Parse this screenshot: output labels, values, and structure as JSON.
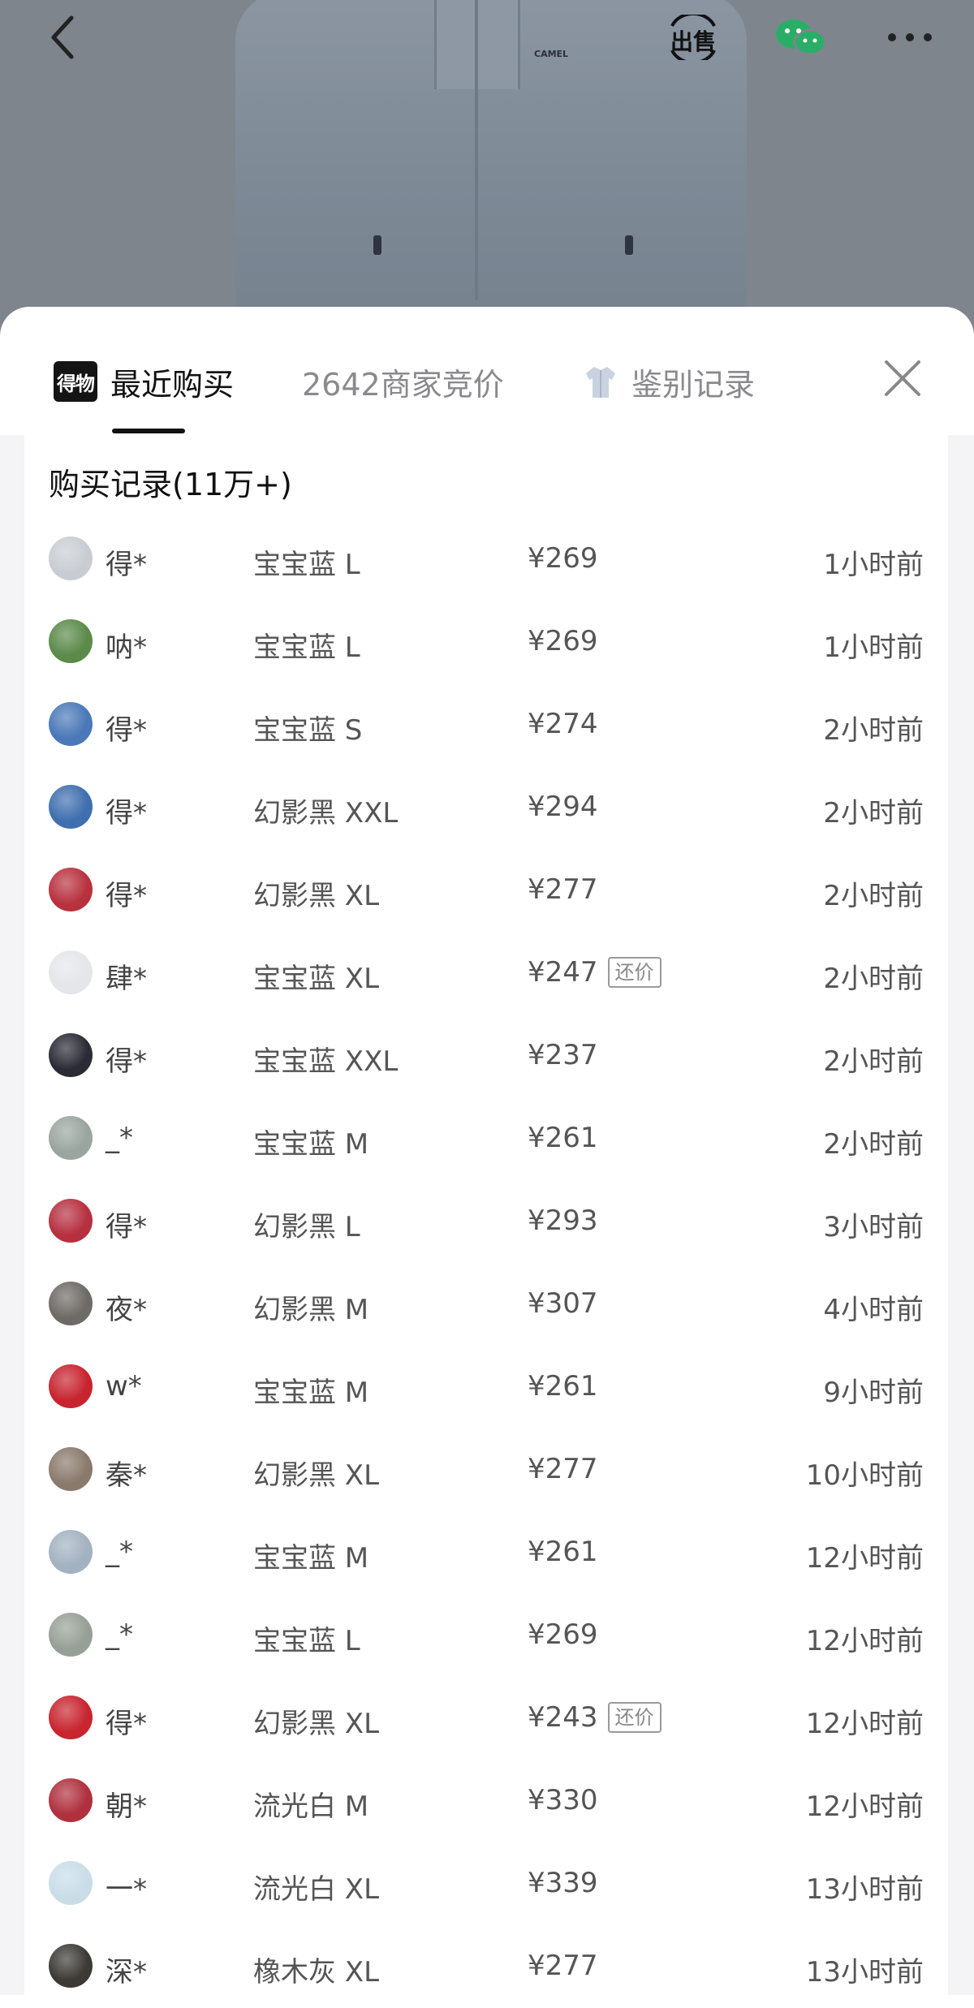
{
  "topbar": {
    "back_icon": "chevron-left-icon",
    "sell_label": "出售",
    "wechat_icon": "wechat-icon",
    "more_icon": "more-dots-icon"
  },
  "product": {
    "logo_text": "CAMEL"
  },
  "tabs": [
    {
      "label": "最近购买",
      "icon": "dewu-logo-icon",
      "icon_text": "得物",
      "active": true
    },
    {
      "label": "2642商家竞价",
      "active": false
    },
    {
      "label": "鉴别记录",
      "icon": "jacket-icon",
      "active": false
    }
  ],
  "section_title": "购买记录(11万+)",
  "colors": {
    "active": "#111111",
    "inactive": "#8a8a8e",
    "tag_border": "#9a9a9a"
  },
  "records": [
    {
      "user": "得*",
      "sku": "宝宝蓝 L",
      "price": "¥269",
      "tag": "",
      "time": "1小时前",
      "avatar_color": "#c9cdd3"
    },
    {
      "user": "呐*",
      "sku": "宝宝蓝 L",
      "price": "¥269",
      "tag": "",
      "time": "1小时前",
      "avatar_color": "#5b8a4a"
    },
    {
      "user": "得*",
      "sku": "宝宝蓝 S",
      "price": "¥274",
      "tag": "",
      "time": "2小时前",
      "avatar_color": "#4a78b8"
    },
    {
      "user": "得*",
      "sku": "幻影黑 XXL",
      "price": "¥294",
      "tag": "",
      "time": "2小时前",
      "avatar_color": "#3f6fae"
    },
    {
      "user": "得*",
      "sku": "幻影黑 XL",
      "price": "¥277",
      "tag": "",
      "time": "2小时前",
      "avatar_color": "#b8323e"
    },
    {
      "user": "肆*",
      "sku": "宝宝蓝 XL",
      "price": "¥247",
      "tag": "还价",
      "time": "2小时前",
      "avatar_color": "#e4e6ea"
    },
    {
      "user": "得*",
      "sku": "宝宝蓝 XXL",
      "price": "¥237",
      "tag": "",
      "time": "2小时前",
      "avatar_color": "#2a2b35"
    },
    {
      "user": "_*",
      "sku": "宝宝蓝 M",
      "price": "¥261",
      "tag": "",
      "time": "2小时前",
      "avatar_color": "#9aa5a0"
    },
    {
      "user": "得*",
      "sku": "幻影黑 L",
      "price": "¥293",
      "tag": "",
      "time": "3小时前",
      "avatar_color": "#b73040"
    },
    {
      "user": "夜*",
      "sku": "幻影黑 M",
      "price": "¥307",
      "tag": "",
      "time": "4小时前",
      "avatar_color": "#6e6a66"
    },
    {
      "user": "w*",
      "sku": "宝宝蓝 M",
      "price": "¥261",
      "tag": "",
      "time": "9小时前",
      "avatar_color": "#c8242f"
    },
    {
      "user": "秦*",
      "sku": "幻影黑 XL",
      "price": "¥277",
      "tag": "",
      "time": "10小时前",
      "avatar_color": "#8a7a6c"
    },
    {
      "user": "_*",
      "sku": "宝宝蓝 M",
      "price": "¥261",
      "tag": "",
      "time": "12小时前",
      "avatar_color": "#a3b2c0"
    },
    {
      "user": "_*",
      "sku": "宝宝蓝 L",
      "price": "¥269",
      "tag": "",
      "time": "12小时前",
      "avatar_color": "#97a097"
    },
    {
      "user": "得*",
      "sku": "幻影黑 XL",
      "price": "¥243",
      "tag": "还价",
      "time": "12小时前",
      "avatar_color": "#c8252f"
    },
    {
      "user": "朝*",
      "sku": "流光白 M",
      "price": "¥330",
      "tag": "",
      "time": "12小时前",
      "avatar_color": "#b0303e"
    },
    {
      "user": "一*",
      "sku": "流光白 XL",
      "price": "¥339",
      "tag": "",
      "time": "13小时前",
      "avatar_color": "#c9dde8"
    },
    {
      "user": "深*",
      "sku": "橡木灰 XL",
      "price": "¥277",
      "tag": "",
      "time": "13小时前",
      "avatar_color": "#3d3a36"
    }
  ]
}
